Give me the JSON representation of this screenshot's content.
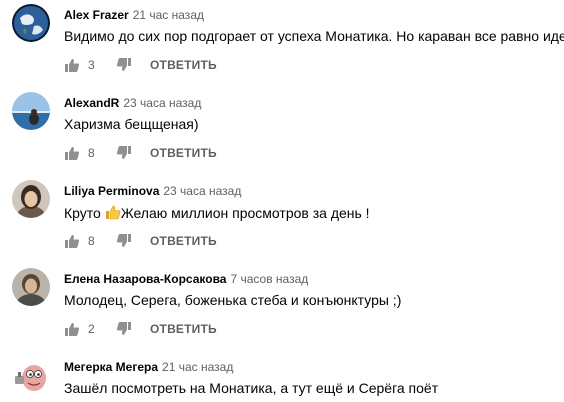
{
  "comments": [
    {
      "author": "Alex Frazer",
      "time": "21 час назад",
      "text": "Видимо до сих пор подгорает от успеха Монатика. Но караван все равно идет.",
      "likes": "3",
      "reply_label": "ОТВЕТИТЬ",
      "avatar_icon": "earth-avatar"
    },
    {
      "author": "AlexandR",
      "time": "23 часа назад",
      "text": "Харизма бещщеная)",
      "likes": "8",
      "reply_label": "ОТВЕТИТЬ",
      "avatar_icon": "sea-avatar"
    },
    {
      "author": "Liliya Perminova",
      "time": "23 часа назад",
      "text_before": "Круто ",
      "text_after": "Желаю миллион просмотров за день !",
      "likes": "8",
      "reply_label": "ОТВЕТИТЬ",
      "avatar_icon": "woman-avatar"
    },
    {
      "author": "Елена Назарова-Корсакова",
      "time": "7 часов назад",
      "text": "Молодец, Серега, боженька стеба и конъюнктуры ;)",
      "likes": "2",
      "reply_label": "ОТВЕТИТЬ",
      "avatar_icon": "woman-avatar"
    },
    {
      "author": "Мегерка Мегера",
      "time": "21 час назад",
      "text": "Зашёл посмотреть на Монатика, а тут ещё и Серёга поёт",
      "avatar_icon": "cartoon-avatar"
    }
  ],
  "colors": {
    "text_primary": "#030303",
    "text_secondary": "#606060",
    "background": "#ffffff"
  }
}
